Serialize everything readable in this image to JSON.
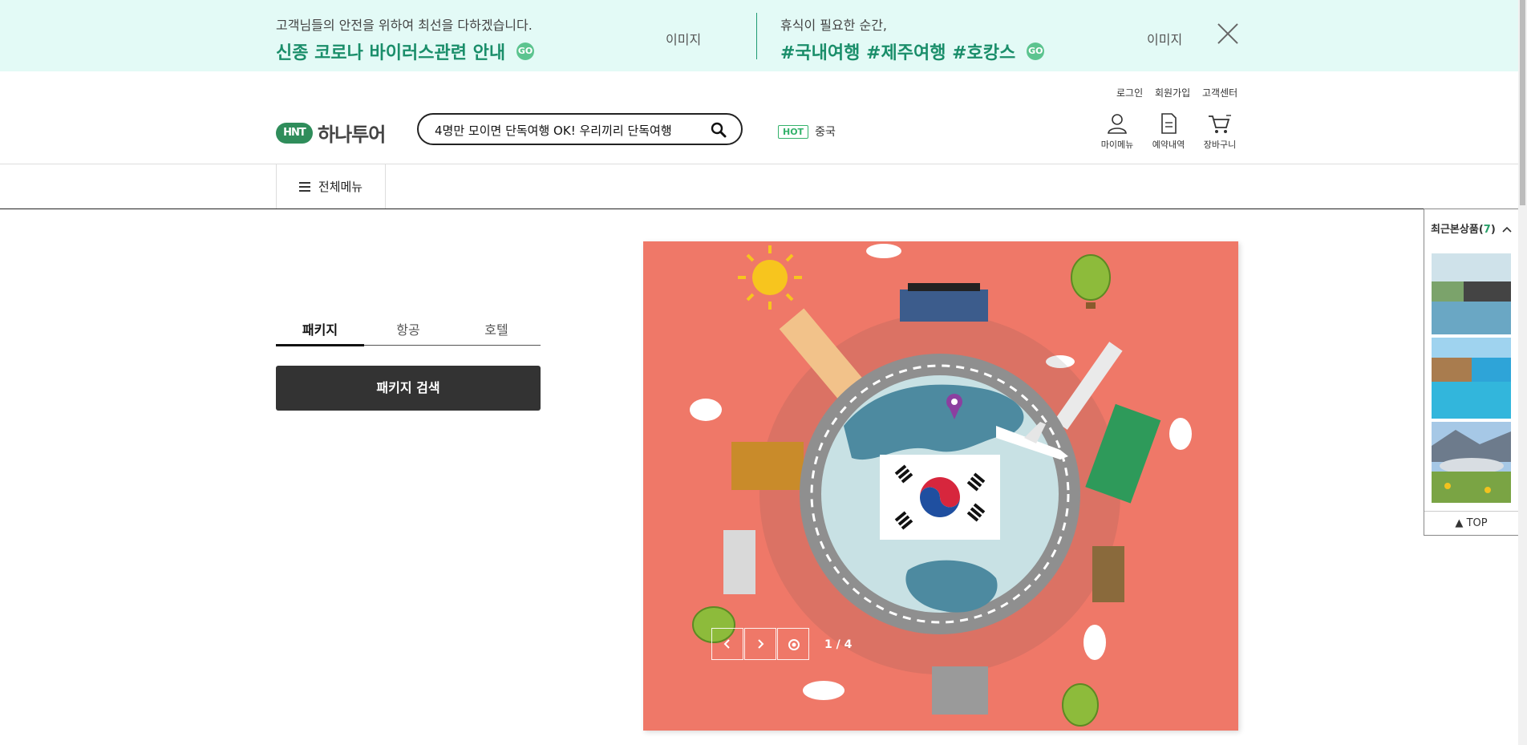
{
  "banner": {
    "left": {
      "sub": "고객님들의 안전을 위하여 최선을 다하겠습니다.",
      "main": "신종 코로나 바이러스관련 안내",
      "go": "GO",
      "image_label": "이미지"
    },
    "right": {
      "sub": "휴식이 필요한 순간,",
      "main": "#국내여행 #제주여행 #호캉스",
      "go": "GO",
      "image_label": "이미지"
    }
  },
  "util_links": [
    "로그인",
    "회원가입",
    "고객센터"
  ],
  "logo": {
    "mark": "HNT",
    "name": "하나투어"
  },
  "search": {
    "query": "4명만 모이면 단독여행 OK! 우리끼리 단독여행"
  },
  "hot": {
    "badge": "HOT",
    "keyword": "중국"
  },
  "header_icons": [
    {
      "label": "마이메뉴",
      "icon": "user-icon"
    },
    {
      "label": "예약내역",
      "icon": "document-icon"
    },
    {
      "label": "장바구니",
      "icon": "cart-icon"
    }
  ],
  "gnb": {
    "all_menu": "전체메뉴"
  },
  "search_tabs": [
    {
      "label": "패키지",
      "active": true
    },
    {
      "label": "항공",
      "active": false
    },
    {
      "label": "호텔",
      "active": false
    }
  ],
  "package_search_button": "패키지 검색",
  "hero": {
    "pager": "1 / 4"
  },
  "recent": {
    "title": "최근본상품",
    "count": "7",
    "top_label": "TOP"
  },
  "colors": {
    "banner_bg": "#e3faf6",
    "accent_green": "#1a8e6a",
    "hero_bg": "#ef7868",
    "button_dark": "#333333"
  }
}
